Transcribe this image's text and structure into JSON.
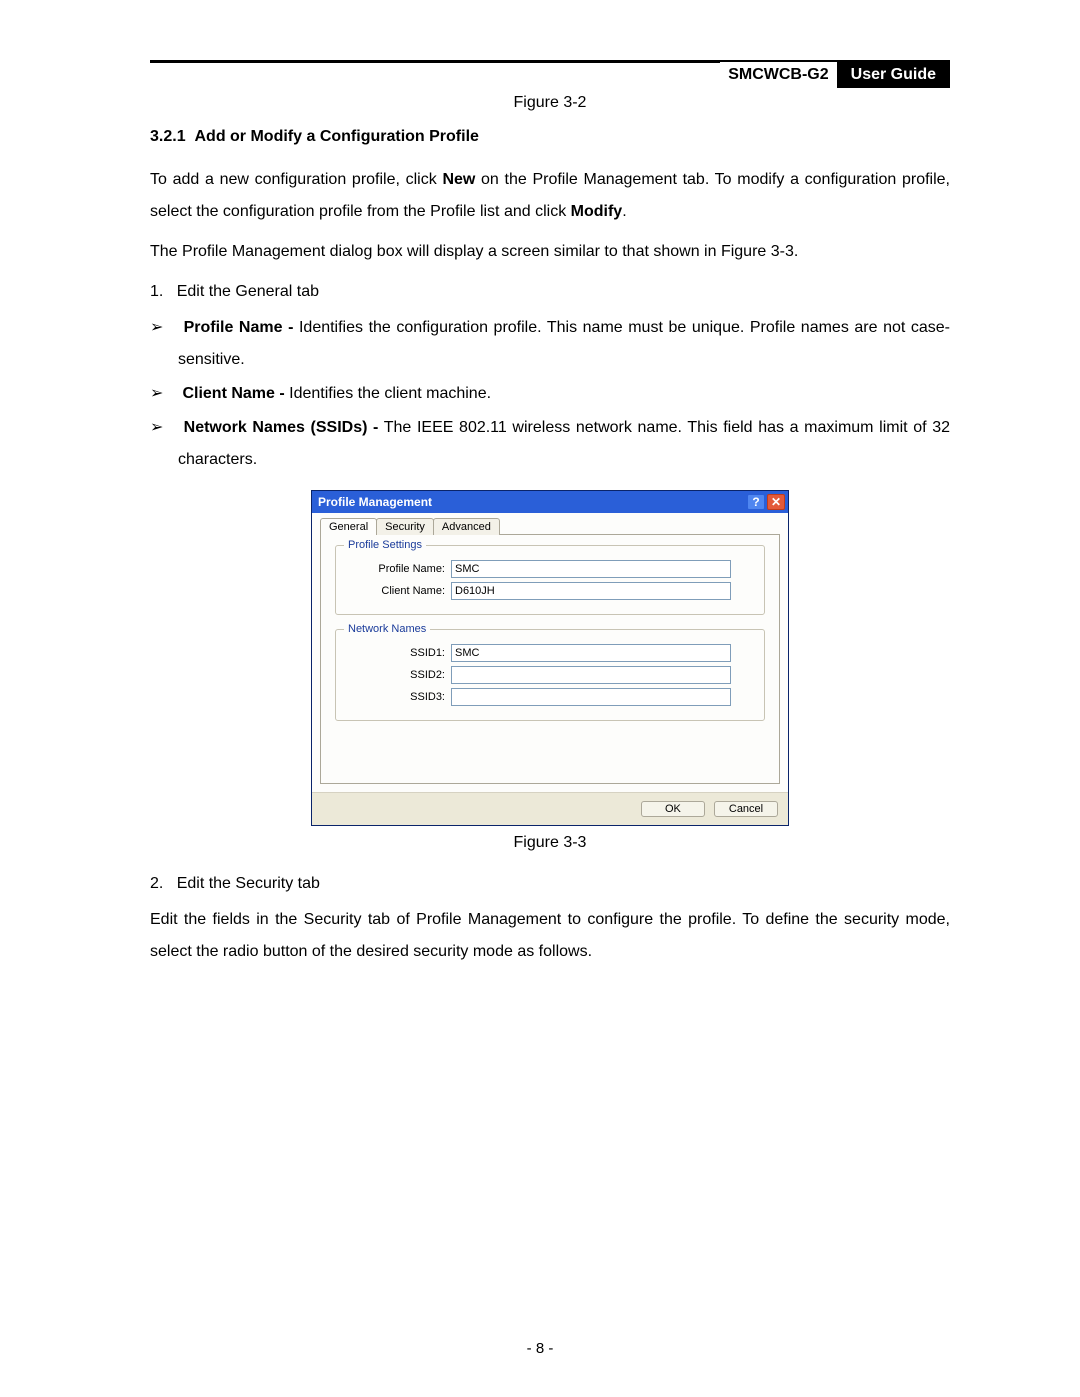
{
  "header": {
    "model": "SMCWCB-G2",
    "guide": "User  Guide"
  },
  "figure_caption_1": "Figure 3-2",
  "section": {
    "number": "3.2.1",
    "title": "Add or Modify a Configuration Profile"
  },
  "para1_a": "To add a new configuration profile, click ",
  "para1_new": "New",
  "para1_b": " on the Profile Management tab. To modify a configuration profile, select the configuration profile from the Profile list and click ",
  "para1_modify": "Modify",
  "para1_c": ".",
  "para2": "The Profile Management dialog box will display a screen similar to that shown in Figure 3-3.",
  "num1_index": "1.",
  "num1_text": "Edit the General tab",
  "bullet1_label": "Profile Name -",
  "bullet1_text": " Identifies the configuration profile. This name must be unique. Profile names are not case-sensitive.",
  "bullet2_label": "Client Name -",
  "bullet2_text": " Identifies the client machine.",
  "bullet3_label": "Network Names (SSIDs) -",
  "bullet3_text": " The IEEE 802.11 wireless network name. This field has a maximum limit of 32 characters.",
  "dialog": {
    "title": "Profile Management",
    "help": "?",
    "close": "✕",
    "tabs": {
      "general": "General",
      "security": "Security",
      "advanced": "Advanced"
    },
    "group_profile": "Profile Settings",
    "label_profile_name": "Profile Name:",
    "val_profile_name": "SMC",
    "label_client_name": "Client Name:",
    "val_client_name": "D610JH",
    "group_network": "Network Names",
    "label_ssid1": "SSID1:",
    "val_ssid1": "SMC",
    "label_ssid2": "SSID2:",
    "val_ssid2": "",
    "label_ssid3": "SSID3:",
    "val_ssid3": "",
    "ok": "OK",
    "cancel": "Cancel"
  },
  "figure_caption_2": "Figure 3-3",
  "num2_index": "2.",
  "num2_text": "Edit the Security tab",
  "para3": "Edit the fields in the Security tab of Profile Management to configure the profile. To define the security mode, select the radio button of the desired security mode as follows.",
  "page_number": "- 8 -"
}
